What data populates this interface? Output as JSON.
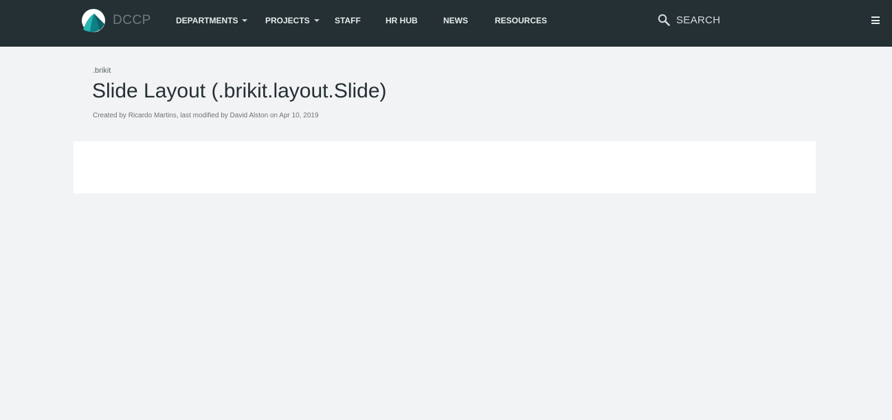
{
  "header": {
    "brand": "DCCP",
    "nav": [
      {
        "label": "DEPARTMENTS",
        "dropdown": true
      },
      {
        "label": "PROJECTS",
        "dropdown": true
      },
      {
        "label": "STAFF",
        "dropdown": false
      },
      {
        "label": "HR HUB",
        "dropdown": false
      },
      {
        "label": "NEWS",
        "dropdown": false
      },
      {
        "label": "RESOURCES",
        "dropdown": false
      }
    ],
    "search_label": "SEARCH",
    "icons": {
      "search": "search-icon",
      "menu": "hamburger-menu-icon",
      "logo": "dccp-logo-icon"
    }
  },
  "page": {
    "breadcrumb": ".brikit",
    "title": "Slide Layout (.brikit.layout.Slide)",
    "byline": {
      "created_prefix": "Created by ",
      "creator": "Ricardo Martins",
      "modified_prefix": ", last modified by ",
      "modifier": "David Alston",
      "date_prefix": " on ",
      "date": "Apr 10, 2019"
    }
  },
  "colors": {
    "topbar": "#243033",
    "page_background": "#f2f3f5",
    "panel": "#ffffff",
    "title": "#243033"
  }
}
